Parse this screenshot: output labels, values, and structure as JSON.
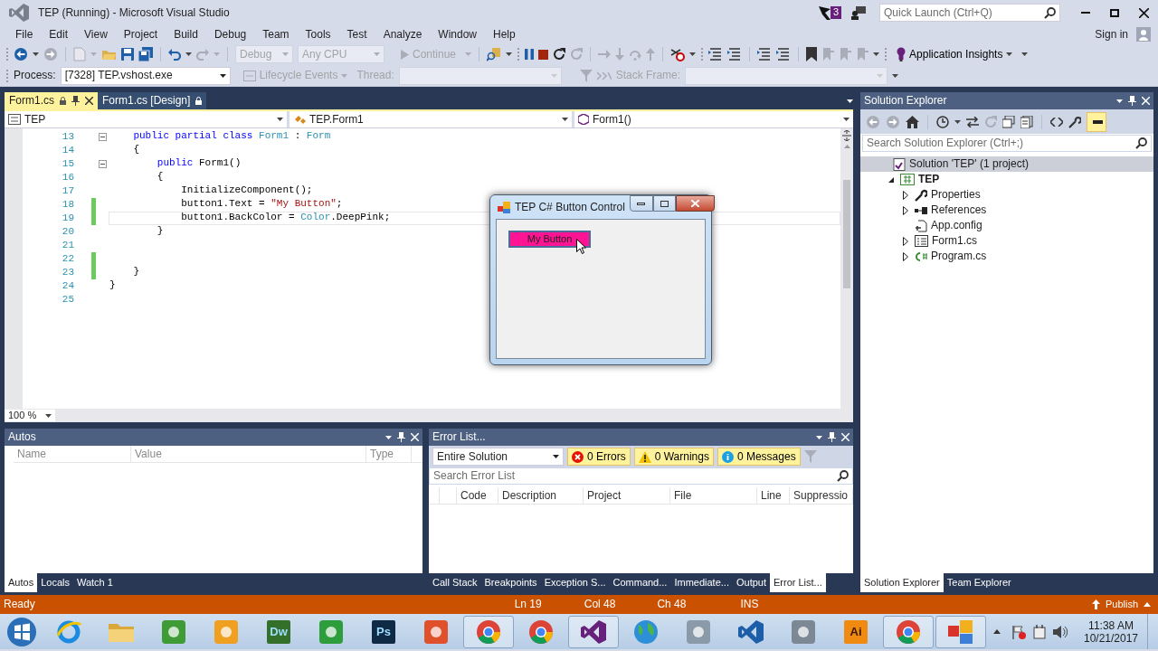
{
  "window": {
    "title": "TEP (Running) - Microsoft Visual Studio"
  },
  "title_bar": {
    "notification_count": "3",
    "quick_launch": {
      "placeholder": "Quick Launch (Ctrl+Q)"
    }
  },
  "menu": [
    "File",
    "Edit",
    "View",
    "Project",
    "Build",
    "Debug",
    "Team",
    "Tools",
    "Test",
    "Analyze",
    "Window",
    "Help"
  ],
  "account": {
    "label": "Sign in"
  },
  "toolbar": {
    "configuration": {
      "value": "Debug",
      "disabled": true
    },
    "platform": {
      "value": "Any CPU",
      "disabled": true
    },
    "continue": {
      "label": "Continue",
      "disabled": true
    },
    "insights": {
      "label": "Application Insights"
    }
  },
  "debug_location": {
    "process": {
      "label": "Process:",
      "value": "[7328] TEP.vshost.exe"
    },
    "lifecycle": {
      "label": "Lifecycle Events",
      "disabled": true
    },
    "thread": {
      "label": "Thread:",
      "disabled": true
    },
    "stack_frame": {
      "label": "Stack Frame:",
      "disabled": true
    }
  },
  "document_tabs": [
    {
      "label": "Form1.cs",
      "selected": true
    },
    {
      "label": "Form1.cs [Design]",
      "selected": false
    }
  ],
  "navigation_bar": [
    "TEP",
    "TEP.Form1",
    "Form1()"
  ],
  "editor": {
    "zoom": "100 %",
    "lines": [
      {
        "number": "13",
        "fold": true,
        "changed": false,
        "current": false,
        "tokens": [
          {
            "text": "    public partial class ",
            "kind": "keyword"
          },
          {
            "text": "Form1",
            "kind": "type"
          },
          {
            "text": " : ",
            "kind": "plain"
          },
          {
            "text": "Form",
            "kind": "type"
          }
        ]
      },
      {
        "number": "14",
        "fold": false,
        "changed": false,
        "current": false,
        "tokens": [
          {
            "text": "    {",
            "kind": "plain"
          }
        ]
      },
      {
        "number": "15",
        "fold": true,
        "changed": false,
        "current": false,
        "tokens": [
          {
            "text": "        public",
            "kind": "keyword"
          },
          {
            "text": " Form1()",
            "kind": "plain"
          }
        ]
      },
      {
        "number": "16",
        "fold": false,
        "changed": false,
        "current": false,
        "tokens": [
          {
            "text": "        {",
            "kind": "plain"
          }
        ]
      },
      {
        "number": "17",
        "fold": false,
        "changed": false,
        "current": false,
        "tokens": [
          {
            "text": "            InitializeComponent();",
            "kind": "plain"
          }
        ]
      },
      {
        "number": "18",
        "fold": false,
        "changed": true,
        "current": false,
        "tokens": [
          {
            "text": "            button1.Text = ",
            "kind": "plain"
          },
          {
            "text": "\"My Button\"",
            "kind": "string"
          },
          {
            "text": ";",
            "kind": "plain"
          }
        ]
      },
      {
        "number": "19",
        "fold": false,
        "changed": true,
        "current": true,
        "tokens": [
          {
            "text": "            button1.BackColor = ",
            "kind": "plain"
          },
          {
            "text": "Color",
            "kind": "type"
          },
          {
            "text": ".DeepPink;",
            "kind": "plain"
          }
        ]
      },
      {
        "number": "20",
        "fold": false,
        "changed": false,
        "current": false,
        "tokens": [
          {
            "text": "        }",
            "kind": "plain"
          }
        ]
      },
      {
        "number": "21",
        "fold": false,
        "changed": false,
        "current": false
      },
      {
        "number": "22",
        "fold": false,
        "changed": true,
        "current": false
      },
      {
        "number": "23",
        "fold": false,
        "changed": true,
        "current": false,
        "tokens": [
          {
            "text": "    }",
            "kind": "plain"
          }
        ]
      },
      {
        "number": "24",
        "fold": false,
        "changed": false,
        "current": false,
        "tokens": [
          {
            "text": "}",
            "kind": "plain"
          }
        ]
      },
      {
        "number": "25",
        "fold": false,
        "changed": false,
        "current": false
      }
    ]
  },
  "running_form": {
    "title": "TEP C# Button Control",
    "button": {
      "label": "My Button",
      "color": "#ff1493"
    }
  },
  "autos": {
    "title": "Autos",
    "columns": [
      "Name",
      "Value",
      "Type"
    ],
    "tabs": [
      {
        "label": "Autos",
        "selected": true
      },
      {
        "label": "Locals",
        "selected": false
      },
      {
        "label": "Watch 1",
        "selected": false
      }
    ]
  },
  "error_list": {
    "title": "Error List...",
    "scope": "Entire Solution",
    "filters": [
      {
        "kind": "error",
        "label": "0 Errors",
        "on": true
      },
      {
        "kind": "warning",
        "label": "0 Warnings",
        "on": true
      },
      {
        "kind": "info",
        "label": "0 Messages",
        "on": true
      }
    ],
    "search": {
      "placeholder": "Search Error List"
    },
    "columns": [
      "Code",
      "Description",
      "Project",
      "File",
      "Line",
      "Suppressio"
    ],
    "tabs": [
      {
        "label": "Call Stack",
        "selected": false
      },
      {
        "label": "Breakpoints",
        "selected": false
      },
      {
        "label": "Exception S...",
        "selected": false
      },
      {
        "label": "Command...",
        "selected": false
      },
      {
        "label": "Immediate...",
        "selected": false
      },
      {
        "label": "Output",
        "selected": false
      },
      {
        "label": "Error List...",
        "selected": true
      }
    ]
  },
  "solution_explorer": {
    "title": "Solution Explorer",
    "preview_on": true,
    "search": {
      "placeholder": "Search Solution Explorer (Ctrl+;)"
    },
    "tree": [
      {
        "label": "Solution 'TEP' (1 project)",
        "kind": "solution",
        "selected": true,
        "children": [
          {
            "label": "TEP",
            "kind": "project",
            "expanded": true,
            "selected": false,
            "children": [
              {
                "label": "Properties",
                "kind": "properties",
                "expanded": false,
                "selected": false
              },
              {
                "label": "References",
                "kind": "references",
                "expanded": false,
                "selected": false
              },
              {
                "label": "App.config",
                "kind": "config",
                "selected": false
              },
              {
                "label": "Form1.cs",
                "kind": "form",
                "expanded": false,
                "selected": false
              },
              {
                "label": "Program.cs",
                "kind": "code",
                "expanded": false,
                "selected": false
              }
            ]
          }
        ]
      }
    ],
    "tabs": [
      {
        "label": "Solution Explorer",
        "selected": true
      },
      {
        "label": "Team Explorer",
        "selected": false
      }
    ]
  },
  "status_bar": {
    "text": "Ready",
    "line": "Ln 19",
    "column": "Col 48",
    "char": "Ch 48",
    "mode": "INS",
    "publish": "Publish"
  },
  "taskbar": {
    "apps": [
      {
        "kind": "ie",
        "running": false
      },
      {
        "kind": "folder",
        "running": false
      },
      {
        "kind": "tile",
        "color": "#3f9b35",
        "running": false
      },
      {
        "kind": "tile",
        "color": "#f0a020",
        "running": false
      },
      {
        "kind": "letters",
        "label": "Dw",
        "color": "#35702a",
        "running": false
      },
      {
        "kind": "tile",
        "color": "#2e9d3c",
        "running": false
      },
      {
        "kind": "letters",
        "label": "Ps",
        "color": "#0f2a45",
        "running": false
      },
      {
        "kind": "tile",
        "color": "#e0502a",
        "running": false
      },
      {
        "kind": "chrome",
        "running": true
      },
      {
        "kind": "chrome",
        "running": false
      },
      {
        "kind": "vs",
        "color": "#68217a",
        "running": true
      },
      {
        "kind": "globe",
        "running": false
      },
      {
        "kind": "tile",
        "color": "#8a9aa8",
        "running": false
      },
      {
        "kind": "vs",
        "color": "#1c5fa8",
        "running": false
      },
      {
        "kind": "tile",
        "color": "#7c8894",
        "running": false
      },
      {
        "kind": "letters",
        "label": "Ai",
        "color": "#f08a10",
        "running": false
      },
      {
        "kind": "chrome",
        "running": true
      },
      {
        "kind": "windows",
        "running": true
      }
    ],
    "clock": {
      "time": "11:38 AM",
      "date": "10/21/2017"
    }
  }
}
